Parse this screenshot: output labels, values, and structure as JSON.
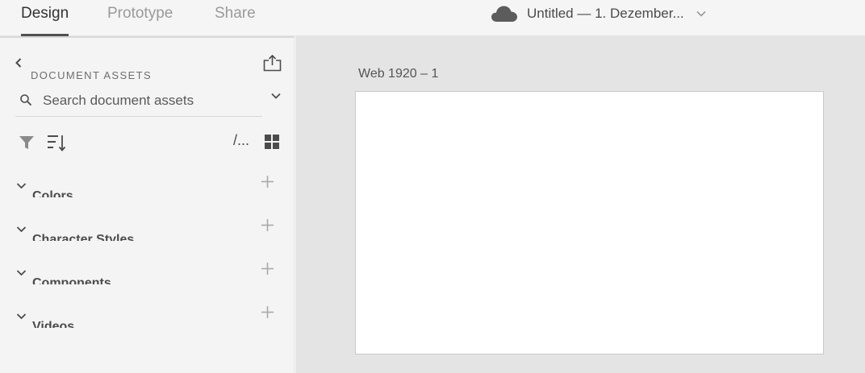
{
  "tabs": {
    "design": "Design",
    "prototype": "Prototype",
    "share": "Share"
  },
  "document": {
    "title": "Untitled — 1. Dezember...",
    "cloud_icon": "cloud-icon",
    "chevron_icon": "chevron-down-icon"
  },
  "assets_panel": {
    "title": "DOCUMENT ASSETS",
    "search_placeholder": "Search document assets",
    "path_label": "/...",
    "sections": [
      {
        "label": "Colors",
        "icon": "chevron-down-icon"
      },
      {
        "label": "Character Styles",
        "icon": "chevron-down-icon"
      },
      {
        "label": "Components",
        "icon": "chevron-down-icon"
      },
      {
        "label": "Videos",
        "icon": "chevron-down-icon"
      }
    ]
  },
  "canvas": {
    "artboard_label": "Web 1920 – 1"
  },
  "colors": {
    "topbar_bg": "#f5f5f5",
    "panel_bg": "#f4f4f4",
    "canvas_bg": "#e4e4e4",
    "artboard_bg": "#ffffff",
    "active_tab_underline": "#505050"
  }
}
